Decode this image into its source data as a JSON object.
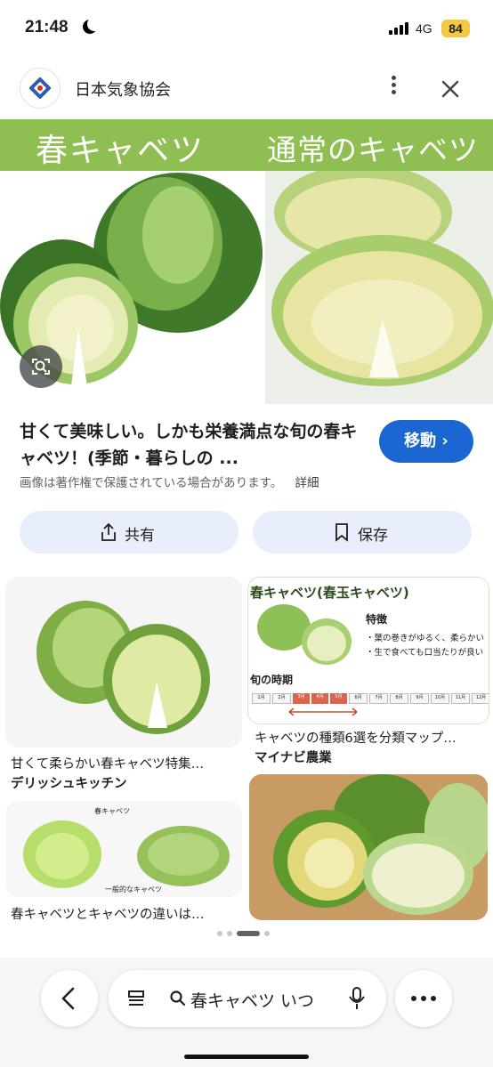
{
  "status_bar": {
    "time": "21:48",
    "network": "4G",
    "battery": "84"
  },
  "header": {
    "site_name": "日本気象協会"
  },
  "hero": {
    "label_left": "春キャベツ",
    "label_right": "通常のキャベツ"
  },
  "result": {
    "title": "甘くて美味しい。しかも栄養満点な旬の春キャベツ！(季節・暮らしの ...",
    "visit_label": "移動",
    "copyright_notice": "画像は著作権で保護されている場合があります。",
    "details_link": "詳細"
  },
  "actions": {
    "share_label": "共有",
    "save_label": "保存"
  },
  "related": {
    "items": [
      {
        "caption": "甘くて柔らかい春キャベツ特集…",
        "source": "デリッシュキッチン"
      },
      {
        "caption": "キャベツの種類6選を分類マップ…",
        "source": "マイナビ農業",
        "thumb_title": "春キャベツ(春玉キャベツ)",
        "thumb_feature_heading": "特徴",
        "thumb_feature_1": "・葉の巻きがゆるく、柔らかい",
        "thumb_feature_2": "・生で食べても口当たりが良い",
        "thumb_season_heading": "旬の時期",
        "thumb_months": [
          "1月",
          "2月",
          "3月",
          "4月",
          "5月",
          "6月",
          "7月",
          "8月",
          "9月",
          "10月",
          "11月",
          "12月"
        ]
      },
      {
        "caption": "春キャベツとキャベツの違いは…",
        "thumb_label_spring": "春キャベツ",
        "thumb_label_normal": "一般的なキャベツ"
      },
      {
        "caption": ""
      }
    ]
  },
  "bottom_bar": {
    "search_query": "春キャベツ いつ"
  },
  "colors": {
    "accent": "#1a67d2",
    "band_green": "#8fbf52",
    "chip_bg": "#e8eefb"
  }
}
